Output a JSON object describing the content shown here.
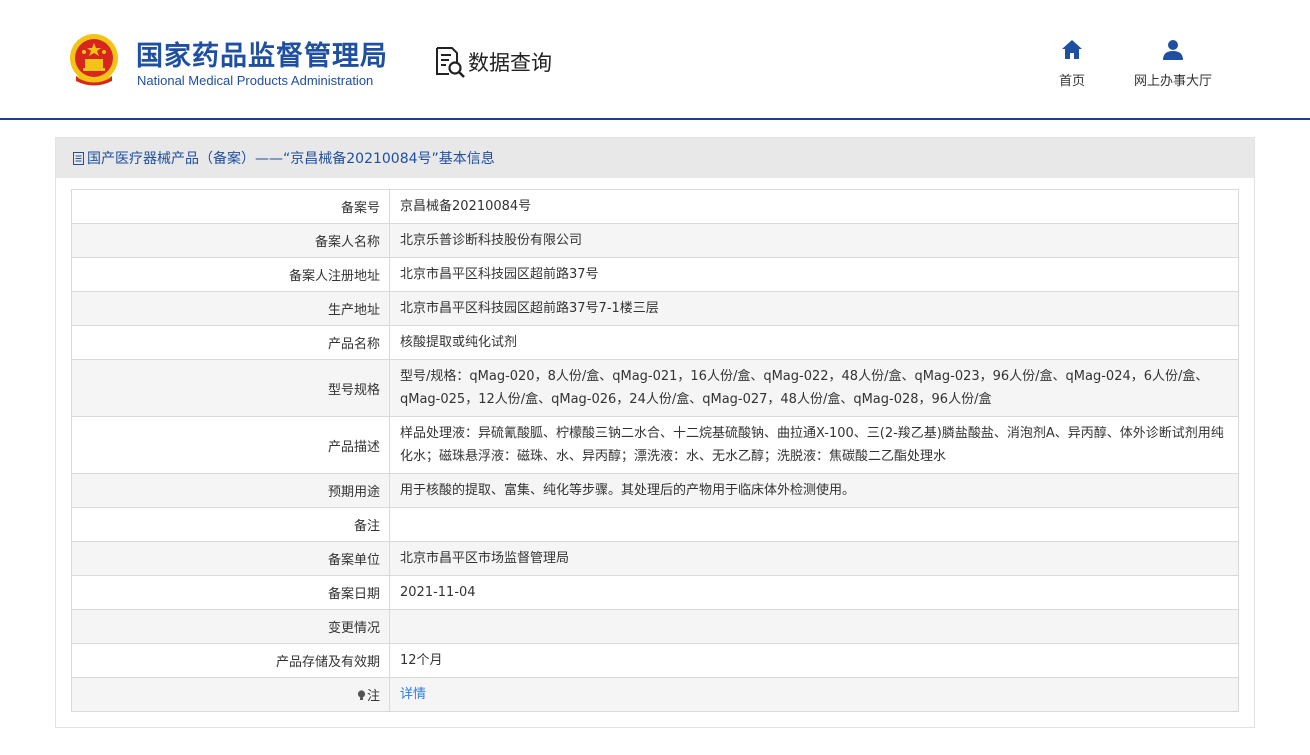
{
  "header": {
    "title_cn": "国家药品监督管理局",
    "title_en": "National Medical Products Administration",
    "query_label": "数据查询",
    "nav": {
      "home": "首页",
      "service": "网上办事大厅"
    }
  },
  "panel": {
    "title": "国产医疗器械产品（备案）——“京昌械备20210084号”基本信息"
  },
  "rows": [
    {
      "label": "备案号",
      "value": "京昌械备20210084号"
    },
    {
      "label": "备案人名称",
      "value": "北京乐普诊断科技股份有限公司"
    },
    {
      "label": "备案人注册地址",
      "value": "北京市昌平区科技园区超前路37号"
    },
    {
      "label": "生产地址",
      "value": "北京市昌平区科技园区超前路37号7-1楼三层"
    },
    {
      "label": "产品名称",
      "value": "核酸提取或纯化试剂"
    },
    {
      "label": "型号规格",
      "value": "型号/规格：qMag-020，8人份/盒、qMag-021，16人份/盒、qMag-022，48人份/盒、qMag-023，96人份/盒、qMag-024，6人份/盒、qMag-025，12人份/盒、qMag-026，24人份/盒、qMag-027，48人份/盒、qMag-028，96人份/盒"
    },
    {
      "label": "产品描述",
      "value": "样品处理液：异硫氰酸胍、柠檬酸三钠二水合、十二烷基硫酸钠、曲拉通X-100、三(2-羧乙基)膦盐酸盐、消泡剂A、异丙醇、体外诊断试剂用纯化水；磁珠悬浮液：磁珠、水、异丙醇；漂洗液：水、无水乙醇；洗脱液：焦碳酸二乙酯处理水"
    },
    {
      "label": "预期用途",
      "value": "用于核酸的提取、富集、纯化等步骤。其处理后的产物用于临床体外检测使用。"
    },
    {
      "label": "备注",
      "value": ""
    },
    {
      "label": "备案单位",
      "value": "北京市昌平区市场监督管理局"
    },
    {
      "label": "备案日期",
      "value": "2021-11-04"
    },
    {
      "label": "变更情况",
      "value": ""
    },
    {
      "label": "产品存储及有效期",
      "value": "12个月"
    }
  ],
  "note": {
    "label": "注",
    "link": "详情"
  },
  "colors": {
    "brand_blue": "#1f4fa0",
    "header_line": "#1e3d8f",
    "link_blue": "#2b7de0",
    "emblem_red": "#d7261e",
    "emblem_gold": "#f3c316"
  }
}
